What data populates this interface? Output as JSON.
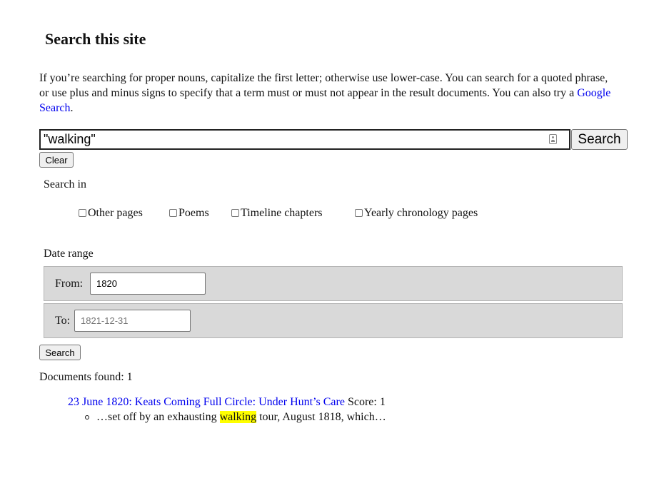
{
  "page": {
    "title": "Search this site",
    "intro": {
      "text_before_link": "If you’re searching for proper nouns, capitalize the first letter; otherwise use lower-case. You can search for a quoted phrase, or use plus and minus signs to specify that a term must or must not appear in the result documents. You can also try a ",
      "link_text": "Google Search",
      "text_after_link": "."
    }
  },
  "search": {
    "query": "\"walking\"",
    "search_button_label": "Search",
    "clear_button_label": "Clear"
  },
  "filters": {
    "heading": "Search in",
    "options": [
      {
        "label": "Other pages",
        "checked": false
      },
      {
        "label": "Poems",
        "checked": false
      },
      {
        "label": "Timeline chapters",
        "checked": false
      },
      {
        "label": "Yearly chronology pages",
        "checked": false
      }
    ]
  },
  "date_range": {
    "heading": "Date range",
    "from_label": "From:",
    "from_value": "1820",
    "to_label": "To:",
    "to_placeholder": "1821-12-31"
  },
  "submit_button_label": "Search",
  "results": {
    "found_text": "Documents found: 1",
    "items": [
      {
        "title": "23 June 1820: Keats Coming Full Circle: Under Hunt’s Care",
        "score_text": "Score: 1",
        "snippet_before": "…set off by an exhausting ",
        "snippet_highlight": "walking",
        "snippet_after": " tour, August 1818, which…"
      }
    ]
  },
  "colors": {
    "link": "#0000ee",
    "highlight": "#ffff00",
    "date_row_bg": "#d9d9d9"
  }
}
